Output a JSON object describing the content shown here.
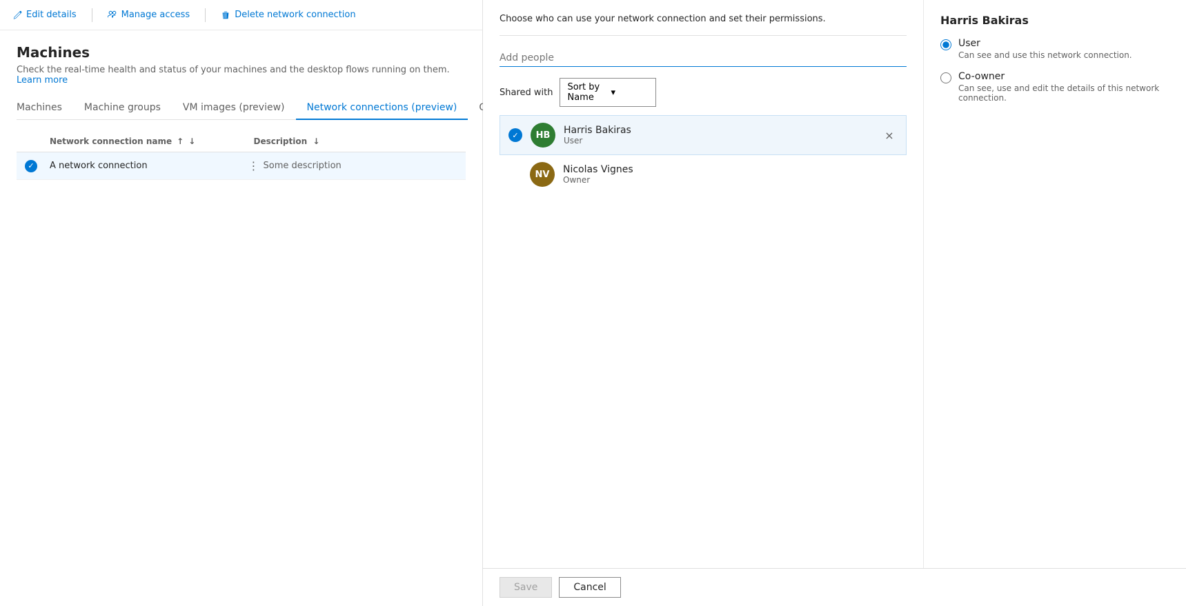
{
  "toolbar": {
    "edit_label": "Edit details",
    "manage_label": "Manage access",
    "delete_label": "Delete network connection"
  },
  "left": {
    "title": "Machines",
    "description": "Check the real-time health and status of your machines and the desktop flows running on them.",
    "learn_more": "Learn more",
    "tabs": [
      {
        "label": "Machines",
        "active": false
      },
      {
        "label": "Machine groups",
        "active": false
      },
      {
        "label": "VM images (preview)",
        "active": false
      },
      {
        "label": "Network connections (preview)",
        "active": true
      },
      {
        "label": "Gateways",
        "active": false
      }
    ],
    "table": {
      "col_name": "Network connection name",
      "col_desc": "Description",
      "rows": [
        {
          "name": "A network connection",
          "description": "Some description",
          "selected": true
        }
      ]
    }
  },
  "right": {
    "description": "Choose who can use your network connection and set their permissions.",
    "add_people_placeholder": "Add people",
    "shared_with_label": "Shared with",
    "sort_label": "Sort by Name",
    "users": [
      {
        "initials": "HB",
        "name": "Harris Bakiras",
        "role": "User",
        "bg": "#2e7d32",
        "selected": true
      },
      {
        "initials": "NV",
        "name": "Nicolas Vignes",
        "role": "Owner",
        "bg": "#8b6914",
        "selected": false
      }
    ],
    "detail": {
      "selected_user": "Harris Bakiras",
      "options": [
        {
          "label": "User",
          "description": "Can see and use this network connection.",
          "selected": true
        },
        {
          "label": "Co-owner",
          "description": "Can see, use and edit the details of this network connection.",
          "selected": false
        }
      ]
    },
    "footer": {
      "save_label": "Save",
      "cancel_label": "Cancel"
    }
  },
  "icons": {
    "edit": "✏️",
    "manage": "👥",
    "delete": "🗑️",
    "chevron_down": "▾",
    "sort_asc": "↑",
    "sort_desc": "↓",
    "more": "⋮",
    "close": "×"
  }
}
